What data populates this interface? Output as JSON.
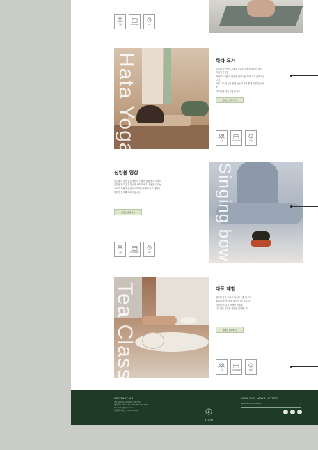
{
  "icon_labels": [
    "그룹",
    "PLANNER",
    "60분"
  ],
  "sections": [
    {
      "title": "하타 요가",
      "photo_text": "Hata Yoga",
      "desc": [
        "고요한 자연속에 자세와 호흡의 조화를 통하여 몸과 마음의 균형을",
        "회복하고 내면의 평화를 찾아가는 하타 요가 클래스입니다.",
        "숙련 지도 강사와 함께 하는 요가를 통해 지친 일상 속 몸",
        "과 마음을 재충전해 보세요."
      ],
      "button": "클래스 예약하기"
    },
    {
      "title": "싱잉볼 명상",
      "photo_text": "Singing bowl Meditation",
      "desc": [
        "싱잉볼이 주는 깊은 울림과 진동에 맞춰 몸과 마음의",
        "긴장을 풀고 깊은 명상에 빠져보세요. 온몸을 감싸는",
        "소리의 파동이 일상의 스트레스를 해소하고 내면의",
        "평화를 찾도록 도와드립니다."
      ],
      "button": "클래스 예약하기"
    },
    {
      "title": "다도 체험",
      "photo_text": "Tea Class",
      "desc": [
        "향긋한 차를 우리고 마시며 전통 다도의",
        "예절과 아름다움을 배우는 시간입니다.",
        "차 한잔의 여유 속에서 마음을",
        "다스리는 특별한 경험을 선사합니다."
      ],
      "button": "클래스 예약하기"
    }
  ],
  "footer": {
    "contact_heading": "CONTACT US",
    "contact_lines": [
      "주소. 제주 서귀포시 중문관광로 72",
      "예약문의. 1544-1234 / FAX. 064-123-4567",
      "E-mail. info@otium.com",
      "사업자등록번호. 123-45-67890"
    ],
    "brand": "OTIUM",
    "newsletter_heading": "JOIN OUR NEWS LETTER",
    "newsletter_placeholder": "Enter your email address"
  }
}
